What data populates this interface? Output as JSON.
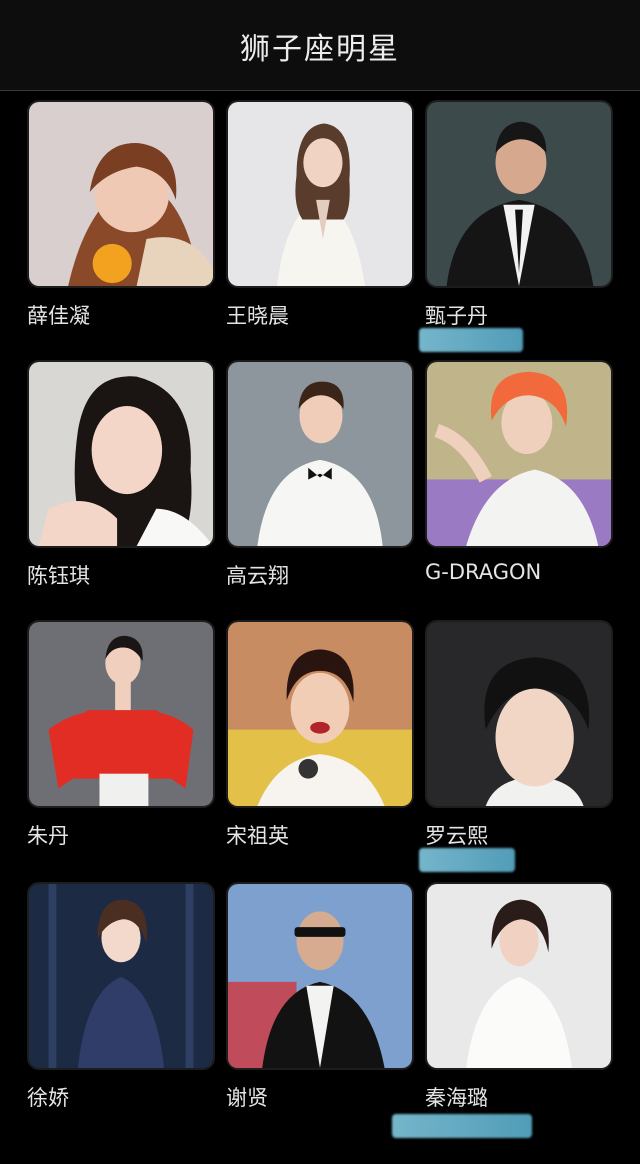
{
  "header": {
    "title": "狮子座明星"
  },
  "stars": [
    {
      "name": "薛佳凝"
    },
    {
      "name": "王晓晨"
    },
    {
      "name": "甄子丹"
    },
    {
      "name": "陈钰琪"
    },
    {
      "name": "高云翔"
    },
    {
      "name": "G-DRAGON"
    },
    {
      "name": "朱丹"
    },
    {
      "name": "宋祖英"
    },
    {
      "name": "罗云熙"
    },
    {
      "name": "徐娇"
    },
    {
      "name": "谢贤"
    },
    {
      "name": "秦海璐"
    }
  ]
}
